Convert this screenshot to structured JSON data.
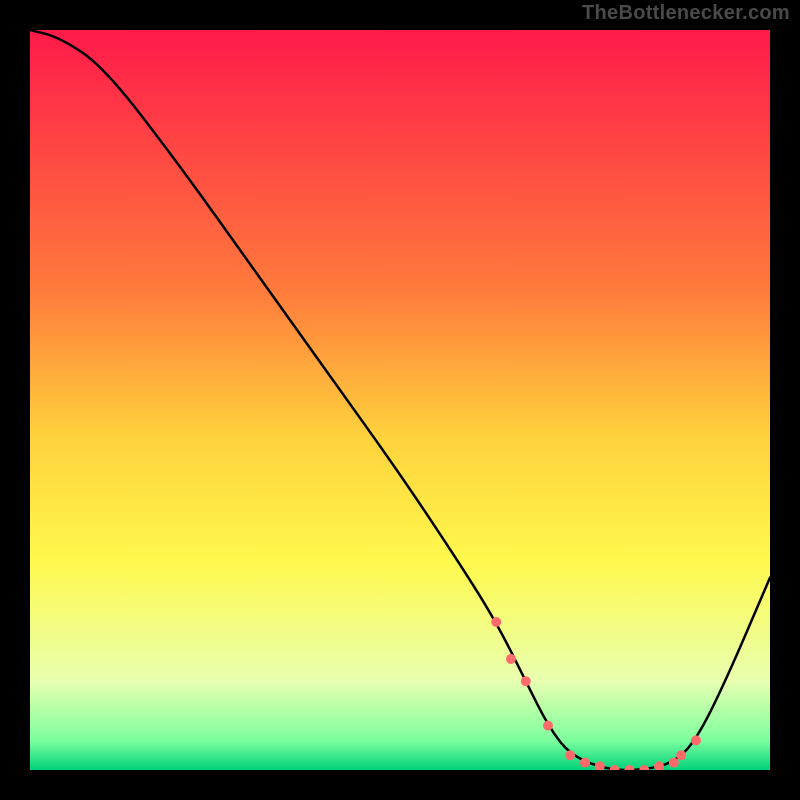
{
  "watermark": "TheBottlenecker.com",
  "chart_data": {
    "type": "line",
    "title": "",
    "xlabel": "",
    "ylabel": "",
    "xlim": [
      0,
      100
    ],
    "ylim": [
      0,
      100
    ],
    "grid": false,
    "legend": false,
    "gradient_stops": [
      {
        "offset": 0,
        "color": "#ff1a4a"
      },
      {
        "offset": 35,
        "color": "#ff7a3c"
      },
      {
        "offset": 55,
        "color": "#ffd23c"
      },
      {
        "offset": 72,
        "color": "#fff94d"
      },
      {
        "offset": 88,
        "color": "#e8ffb0"
      },
      {
        "offset": 96,
        "color": "#7cff9e"
      },
      {
        "offset": 100,
        "color": "#00d27a"
      }
    ],
    "series": [
      {
        "name": "bottleneck-curve",
        "color": "#000000",
        "x": [
          0,
          4,
          10,
          20,
          30,
          40,
          50,
          58,
          63,
          67,
          70,
          73,
          78,
          83,
          87,
          90,
          94,
          100
        ],
        "y": [
          100,
          99,
          95,
          82,
          68,
          54,
          40,
          28,
          20,
          12,
          6,
          2,
          0,
          0,
          1,
          4,
          12,
          26
        ]
      }
    ],
    "markers": {
      "name": "highlight-points",
      "color": "#ff6b6b",
      "radius": 5,
      "x": [
        63,
        65,
        67,
        70,
        73,
        75,
        77,
        79,
        81,
        83,
        85,
        87,
        88,
        90
      ],
      "y": [
        20,
        15,
        12,
        6,
        2,
        1,
        0.5,
        0,
        0,
        0,
        0.5,
        1,
        2,
        4
      ]
    }
  }
}
